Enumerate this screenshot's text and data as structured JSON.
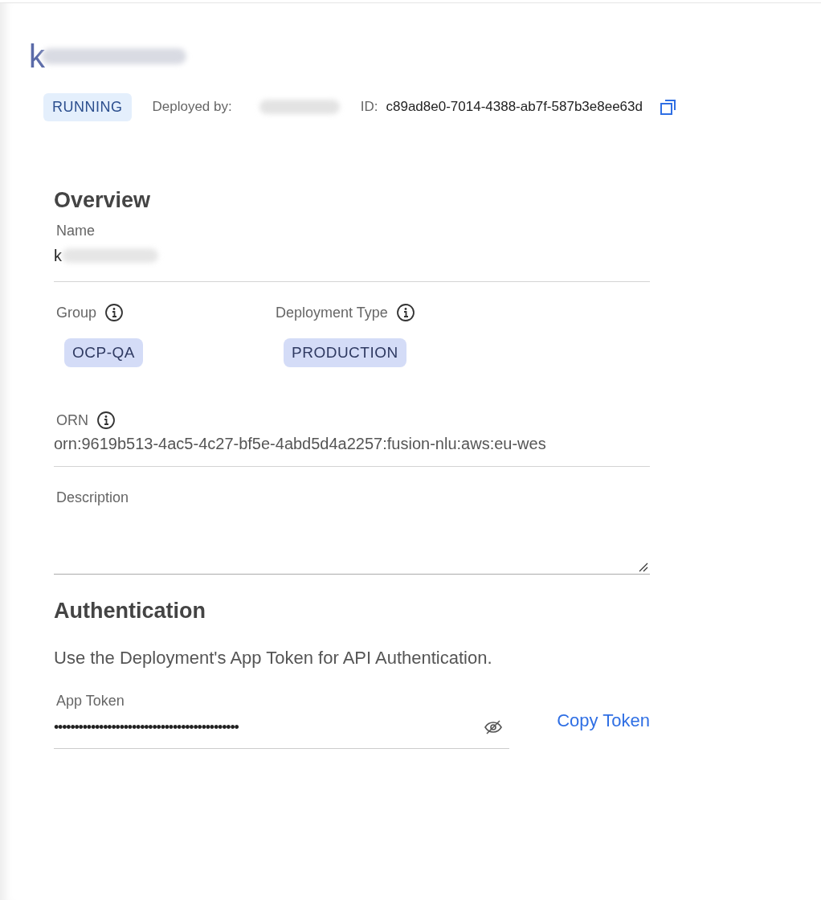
{
  "header": {
    "title": "k",
    "status": "RUNNING",
    "deployed_by_label": "Deployed by:",
    "id_label": "ID:",
    "id_value": "c89ad8e0-7014-4388-ab7f-587b3e8ee63d"
  },
  "overview": {
    "heading": "Overview",
    "name": {
      "label": "Name",
      "value": "k"
    },
    "group": {
      "label": "Group",
      "value": "OCP-QA"
    },
    "deployment_type": {
      "label": "Deployment Type",
      "value": "PRODUCTION"
    },
    "orn": {
      "label": "ORN",
      "value": "orn:9619b513-4ac5-4c27-bf5e-4abd5d4a2257:fusion-nlu:aws:eu-wes"
    },
    "description": {
      "label": "Description"
    }
  },
  "authentication": {
    "heading": "Authentication",
    "text": "Use the Deployment's App Token for API Authentication.",
    "token_label": "App Token",
    "token_value": "•••••••••••••••••••••••••••••••••••••••••••••",
    "copy_button": "Copy Token"
  }
}
